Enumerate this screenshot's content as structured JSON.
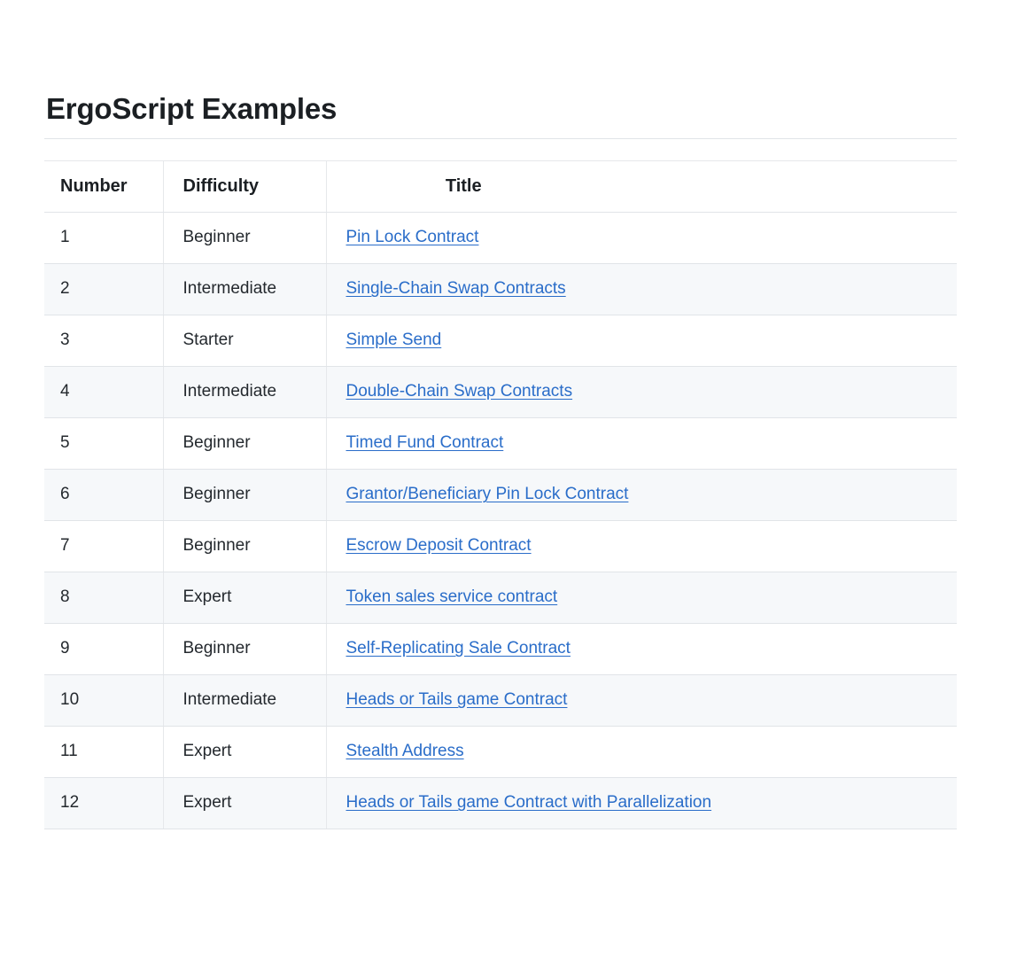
{
  "page": {
    "title": "ErgoScript Examples"
  },
  "table": {
    "columns": [
      {
        "key": "number",
        "label": "Number",
        "align": "left"
      },
      {
        "key": "difficulty",
        "label": "Difficulty",
        "align": "left"
      },
      {
        "key": "title",
        "label": "Title",
        "align": "center"
      }
    ],
    "rows": [
      {
        "number": "1",
        "difficulty": "Beginner",
        "title": "Pin Lock Contract"
      },
      {
        "number": "2",
        "difficulty": "Intermediate",
        "title": "Single-Chain Swap Contracts"
      },
      {
        "number": "3",
        "difficulty": "Starter",
        "title": "Simple Send"
      },
      {
        "number": "4",
        "difficulty": "Intermediate",
        "title": "Double-Chain Swap Contracts"
      },
      {
        "number": "5",
        "difficulty": "Beginner",
        "title": "Timed Fund Contract"
      },
      {
        "number": "6",
        "difficulty": "Beginner",
        "title": "Grantor/Beneficiary Pin Lock Contract"
      },
      {
        "number": "7",
        "difficulty": "Beginner",
        "title": "Escrow Deposit Contract"
      },
      {
        "number": "8",
        "difficulty": "Expert",
        "title": "Token sales service contract"
      },
      {
        "number": "9",
        "difficulty": "Beginner",
        "title": "Self-Replicating Sale Contract"
      },
      {
        "number": "10",
        "difficulty": "Intermediate",
        "title": "Heads or Tails game Contract"
      },
      {
        "number": "11",
        "difficulty": "Expert",
        "title": "Stealth Address"
      },
      {
        "number": "12",
        "difficulty": "Expert",
        "title": "Heads or Tails game Contract with Parallelization"
      }
    ]
  },
  "colors": {
    "link": "#2a6dc9",
    "text": "#24292e",
    "heading": "#1b1f23",
    "border": "#e1e4e8",
    "stripe": "#f6f8fa",
    "background": "#ffffff"
  }
}
